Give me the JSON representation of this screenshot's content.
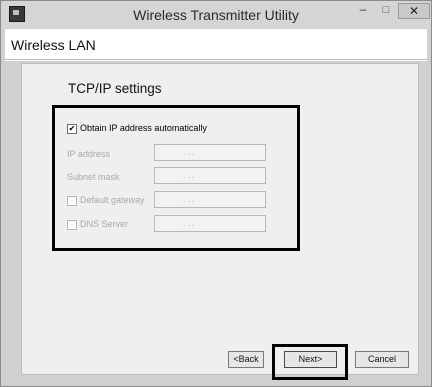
{
  "window": {
    "title": "Wireless Transmitter Utility",
    "minimize_glyph": "–",
    "maximize_glyph": "□",
    "close_glyph": "✕"
  },
  "header": {
    "section_title": "Wireless LAN"
  },
  "content": {
    "heading": "TCP/IP settings",
    "obtain_auto": {
      "label": "Obtain IP address automatically",
      "checked": true,
      "check_glyph": "✔"
    },
    "ip_address": {
      "label": "IP address",
      "value": ". . ."
    },
    "subnet_mask": {
      "label": "Subnet mask",
      "value": ". . ."
    },
    "default_gateway": {
      "label": "Default gateway",
      "checked": false,
      "value": ". . ."
    },
    "dns_server": {
      "label": "DNS Server",
      "checked": false,
      "value": ". . ."
    }
  },
  "buttons": {
    "back": "<Back",
    "next": "Next>",
    "cancel": "Cancel"
  },
  "icons": {
    "app": "wireless-transmitter-app-icon",
    "minimize": "minimize-icon",
    "maximize": "maximize-icon",
    "close": "close-icon"
  }
}
